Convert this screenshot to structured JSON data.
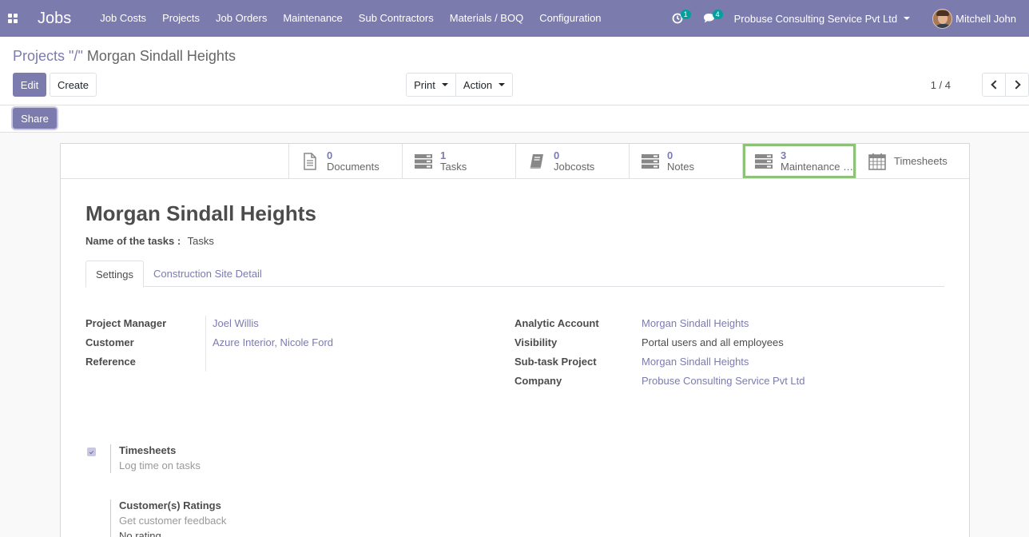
{
  "navbar": {
    "brand": "Jobs",
    "menu": [
      "Job Costs",
      "Projects",
      "Job Orders",
      "Maintenance",
      "Sub Contractors",
      "Materials / BOQ",
      "Configuration"
    ],
    "activity_count": "1",
    "messages_count": "4",
    "company": "Probuse Consulting Service Pvt Ltd",
    "user": "Mitchell John"
  },
  "breadcrumb": {
    "parent": "Projects",
    "separator": "\"/\"",
    "current": "Morgan Sindall Heights"
  },
  "buttons": {
    "edit": "Edit",
    "create": "Create",
    "print": "Print",
    "action": "Action",
    "share": "Share"
  },
  "pager": {
    "text": "1 / 4"
  },
  "smart_buttons": [
    {
      "value": "0",
      "label": "Documents",
      "icon": "document-icon"
    },
    {
      "value": "1",
      "label": "Tasks",
      "icon": "tasks-icon"
    },
    {
      "value": "0",
      "label": "Jobcosts",
      "icon": "book-icon"
    },
    {
      "value": "0",
      "label": "Notes",
      "icon": "notes-icon"
    },
    {
      "value": "3",
      "label": "Maintenance Requests",
      "icon": "maintenance-icon"
    },
    {
      "value": "",
      "label": "Timesheets",
      "icon": "calendar-icon"
    }
  ],
  "form": {
    "title": "Morgan Sindall Heights",
    "task_name_label": "Name of the tasks :",
    "task_name_value": "Tasks",
    "tabs": [
      "Settings",
      "Construction Site Detail"
    ],
    "left_fields": [
      {
        "label": "Project Manager",
        "value": "Joel Willis"
      },
      {
        "label": "Customer",
        "value": "Azure Interior, Nicole Ford"
      },
      {
        "label": "Reference",
        "value": ""
      }
    ],
    "right_fields": [
      {
        "label": "Analytic Account",
        "value": "Morgan Sindall Heights"
      },
      {
        "label": "Visibility",
        "value": "Portal users and all employees"
      },
      {
        "label": "Sub-task Project",
        "value": "Morgan Sindall Heights"
      },
      {
        "label": "Company",
        "value": "Probuse Consulting Service Pvt Ltd"
      }
    ],
    "options": [
      {
        "title": "Timesheets",
        "desc": "Log time on tasks",
        "extra": ""
      },
      {
        "title": "Customer(s) Ratings",
        "desc": "Get customer feedback",
        "extra": "No rating"
      }
    ]
  },
  "colors": {
    "brand": "#7c7bad",
    "highlight": "#8fc279"
  }
}
